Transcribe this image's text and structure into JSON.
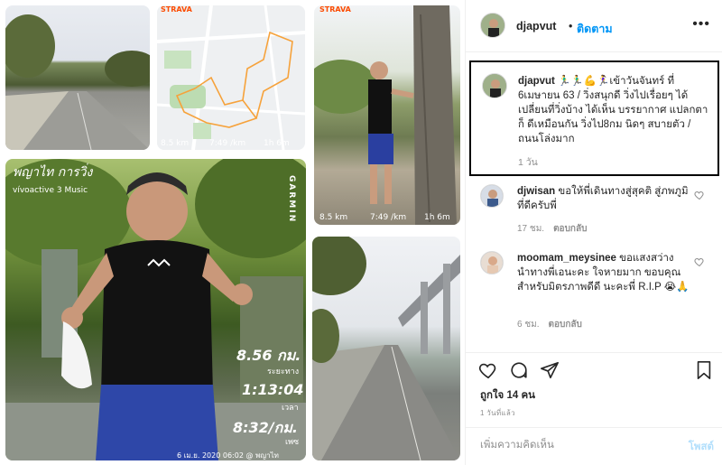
{
  "collage": {
    "strava_logo_1": "STRAVA",
    "strava_logo_2": "STRAVA",
    "map_stats": [
      "8.5 km",
      "7:49 /km",
      "1h 6m"
    ],
    "portrait_stats": [
      "8.5 km",
      "7:49 /km",
      "1h 6m"
    ],
    "activity_title": "พญาไท การวิ่ง",
    "watch_name": "vívoactive 3 Music",
    "garmin_logo": "GARMIN",
    "distance_value": "8.56 กม.",
    "distance_label": "ระยะทาง",
    "time_value": "1:13:04",
    "time_label": "เวลา",
    "pace_value": "8:32/กม.",
    "pace_label": "เพซ",
    "photo_footer": "6 เม.ย. 2020 06:02 @ พญาไท"
  },
  "header": {
    "username": "djapvut",
    "dot": "•",
    "follow_label": "ติดตาม",
    "more_icon": "more-horizontal-icon"
  },
  "caption": {
    "username": "djapvut",
    "text": "🏃‍♂️🏃‍♂️💪🏃‍♀️เข้าวันจันทร์ ที่ 6เมษายน 63 / วิ่งสนุกดี วิ่งไปเรื่อยๆ ได้เปลี่ยนที่วิ่งบ้าง ได้เห็น บรรยากาศ แปลกตาก็ ดีเหมือนกัน วิ่งไป8กม นิดๆ สบายตัว / ถนนโล่งมาก",
    "time": "1 วัน"
  },
  "comments": [
    {
      "username": "djwisan",
      "text": "ขอให้พี่เดินทางสู่สุคติ สู่ภพภูมิที่ดีครับพี่",
      "time": "17 ชม.",
      "reply": "ตอบกลับ"
    },
    {
      "username": "moomam_meysinee",
      "text": "ขอแสงสว่างนำทางพี่เอนะคะ ใจหายมาก ขอบคุณสำหรับมิตรภาพดีดี นะคะพี่ R.I.P 😭🙏",
      "time": "6 ชม.",
      "reply": "ตอบกลับ"
    }
  ],
  "actions": {
    "likes": "ถูกใจ 14 คน",
    "date": "1 วันที่แล้ว",
    "comment_placeholder": "เพิ่มความคิดเห็น",
    "post_label": "โพสต์"
  }
}
